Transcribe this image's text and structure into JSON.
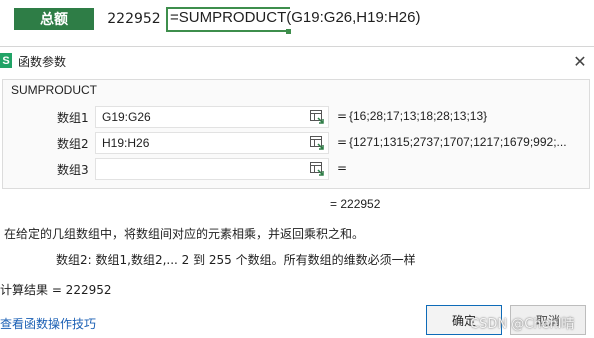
{
  "sheet": {
    "total_label": "总额",
    "total_value": "222952",
    "formula": "=SUMPRODUCT(G19:G26,H19:H26)"
  },
  "dialog": {
    "app_icon_letter": "S",
    "title": "函数参数",
    "close_glyph": "✕",
    "function_name": "SUMPRODUCT",
    "args": [
      {
        "label": "数组1",
        "value": "G19:G26",
        "eq": "=",
        "result": "{16;28;17;13;18;28;13;13}"
      },
      {
        "label": "数组2",
        "value": "H19:H26",
        "eq": "=",
        "result": "{1271;1315;2737;1707;1217;1679;992;..."
      },
      {
        "label": "数组3",
        "value": "",
        "eq": "=",
        "result": ""
      }
    ],
    "overall_result": "=  222952",
    "description": "在给定的几组数组中，将数组间对应的元素相乘，并返回乘积之和。",
    "param_description": "数组2:   数组1,数组2,... 2 到 255 个数组。所有数组的维数必须一样",
    "calc_result": "计算结果  =  222952",
    "help_link": "查看函数操作技巧",
    "ok_label": "确定",
    "cancel_label": "取消",
    "watermark": "CSDN @Chenl晴"
  },
  "colors": {
    "header_green": "#2e7d46",
    "link_blue": "#1a5fb4",
    "ok_border": "#0e6bb8"
  },
  "icons": {
    "app": "spreadsheet-app-icon",
    "ref": "range-select-icon",
    "close": "close-icon"
  }
}
